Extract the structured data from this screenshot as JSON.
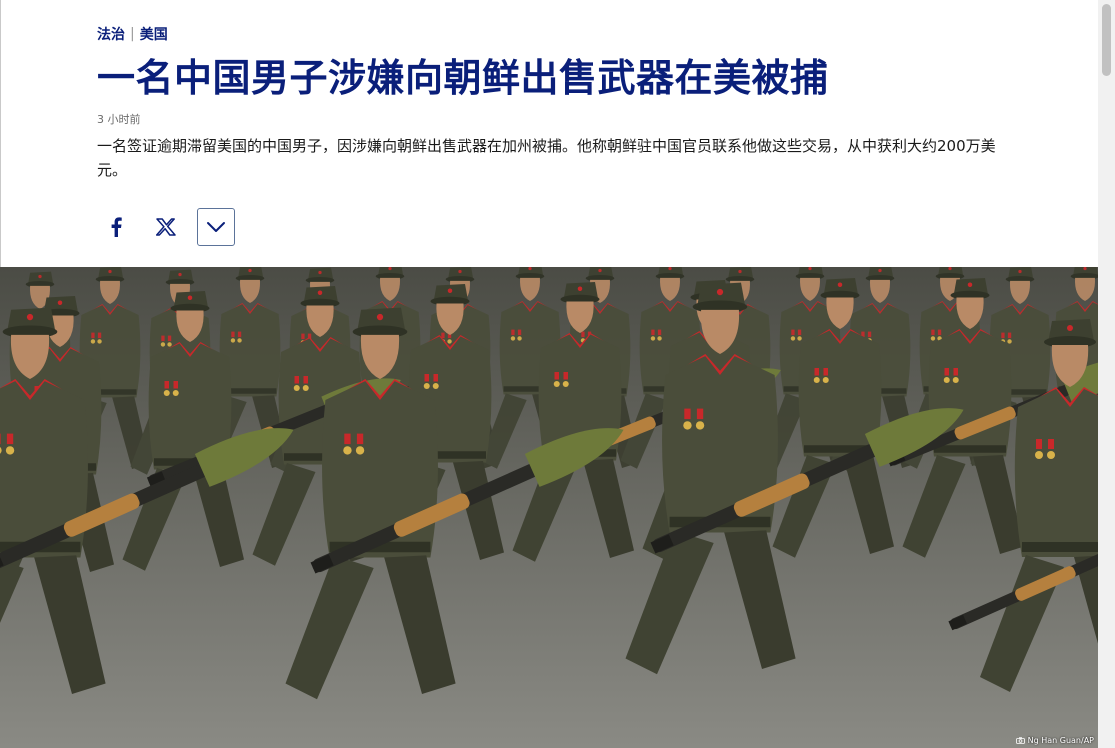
{
  "breadcrumb": {
    "section": "法治",
    "separator": "|",
    "region": "美国"
  },
  "article": {
    "title": "一名中国男子涉嫌向朝鲜出售武器在美被捕",
    "timestamp": "3 小时前",
    "teaser": "一名签证逾期滞留美国的中国男子，因涉嫌向朝鲜出售武器在加州被捕。他称朝鲜驻中国官员联系他做这些交易，从中获利大约200万美元。"
  },
  "share": {
    "facebook_icon": "facebook-icon",
    "x_icon": "x-icon",
    "more_icon": "chevron-down-icon"
  },
  "image": {
    "credit": "Ng Han Guan/AP",
    "credit_icon": "camera-icon"
  },
  "colors": {
    "brand": "#0a1f7a",
    "uniform": "#4a4d3a",
    "collar_red": "#c8282a",
    "launcher_green": "#6e7a3a",
    "wood": "#b5803e"
  }
}
